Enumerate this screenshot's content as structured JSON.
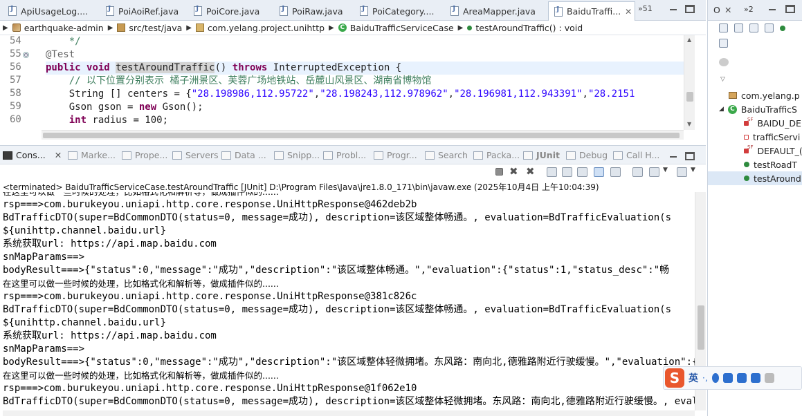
{
  "editor_tabs": [
    {
      "label": "ApiUsageLog...."
    },
    {
      "label": "PoiAoiRef.java"
    },
    {
      "label": "PoiCore.java"
    },
    {
      "label": "PoiRaw.java"
    },
    {
      "label": "PoiCategory...."
    },
    {
      "label": "AreaMapper.java"
    },
    {
      "label": "BaiduTraffi...",
      "active": true
    }
  ],
  "editor_overflow": "»51",
  "breadcrumb": {
    "project": "earthquake-admin",
    "folder": "src/test/java",
    "package": "com.yelang.project.unihttp",
    "class": "BaiduTrafficServiceCase",
    "method": "testAroundTraffic() : void"
  },
  "code": {
    "line_numbers": [
      "54",
      "55",
      "56",
      "57",
      "58",
      "59",
      "60"
    ],
    "fold_marker": "⊖",
    "lines": [
      {
        "t1": "    */"
      },
      {
        "ann": "@Test"
      },
      {
        "kw1": "public",
        "kw2": "void",
        "method": "testAroundTraffic",
        "rest": "() ",
        "kw3": "throws",
        "rest2": " InterruptedException {"
      },
      {
        "comment": "    // 以下位置分别表示 橘子洲景区、芙蓉广场地铁站、岳麓山风景区、湖南省博物馆"
      },
      {
        "pre": "    String [] ",
        "var": "centers",
        "eq": " = {",
        "s1": "\"28.198986,112.95722\"",
        "c1": ",",
        "s2": "\"28.198243,112.978962\"",
        "c2": ",",
        "s3": "\"28.196981,112.943391\"",
        "c3": ",",
        "s4": "\"28.2151"
      },
      {
        "pre": "    Gson gson = ",
        "kw": "new",
        "post": " Gson();"
      },
      {
        "kw": "    int",
        "post": " radius = 100;"
      }
    ]
  },
  "console_tabs": [
    {
      "label": "Cons...",
      "active": true
    },
    {
      "label": "Marke..."
    },
    {
      "label": "Prope..."
    },
    {
      "label": "Servers"
    },
    {
      "label": "Data ..."
    },
    {
      "label": "Snipp..."
    },
    {
      "label": "Probl..."
    },
    {
      "label": "Progr..."
    },
    {
      "label": "Search"
    },
    {
      "label": "Packa..."
    },
    {
      "label": "JUnit"
    },
    {
      "label": "Debug"
    },
    {
      "label": "Call H..."
    }
  ],
  "console_status": "<terminated> BaiduTrafficServiceCase.testAroundTraffic [JUnit] D:\\Program Files\\Java\\jre1.8.0_171\\bin\\javaw.exe (2025年10月4日 上午10:04:39)",
  "console_lines": [
    {
      "text": "在这里可以做一些时候的处理，比如格式化和解析等，做成插件似的......",
      "cn": true
    },
    {
      "text": "rsp===>com.burukeyou.uniapi.http.core.response.UniHttpResponse@462deb2b"
    },
    {
      "text": "BdTrafficDTO(super=BdCommonDTO(status=0, message=成功), description=该区域整体畅通。, evaluation=BdTrafficEvaluation(s"
    },
    {
      "text": "${unihttp.channel.baidu.url}"
    },
    {
      "text": "系统获取url: https://api.map.baidu.com"
    },
    {
      "text": "snMapParams==>"
    },
    {
      "text": "bodyResult===>{\"status\":0,\"message\":\"成功\",\"description\":\"该区域整体畅通。\",\"evaluation\":{\"status\":1,\"status_desc\":\"畅"
    },
    {
      "text": "在这里可以做一些时候的处理，比如格式化和解析等，做成插件似的......",
      "cn": true
    },
    {
      "text": "rsp===>com.burukeyou.uniapi.http.core.response.UniHttpResponse@381c826c"
    },
    {
      "text": "BdTrafficDTO(super=BdCommonDTO(status=0, message=成功), description=该区域整体畅通。, evaluation=BdTrafficEvaluation(s"
    },
    {
      "text": "${unihttp.channel.baidu.url}"
    },
    {
      "text": "系统获取url: https://api.map.baidu.com"
    },
    {
      "text": "snMapParams==>"
    },
    {
      "text": "bodyResult===>{\"status\":0,\"message\":\"成功\",\"description\":\"该区域整体轻微拥堵。东风路：南向北,德雅路附近行驶缓慢。\",\"evaluation\":{\""
    },
    {
      "text": "在这里可以做一些时候的处理，比如格式化和解析等，做成插件似的......",
      "cn": true
    },
    {
      "text": "rsp===>com.burukeyou.uniapi.http.core.response.UniHttpResponse@1f062e10"
    },
    {
      "text": "BdTrafficDTO(super=BdCommonDTO(status=0, message=成功), description=该区域整体轻微拥堵。东风路：南向北,德雅路附近行驶缓慢。, evalu"
    }
  ],
  "outline_tabs": [
    {
      "label": "O"
    },
    {
      "label": "»2"
    }
  ],
  "outline_items": [
    {
      "label": "com.yelang.p",
      "kind": "package"
    },
    {
      "label": "BaiduTrafficS",
      "kind": "class"
    },
    {
      "label": "BAIDU_DE",
      "kind": "field-sf"
    },
    {
      "label": "trafficServi",
      "kind": "field"
    },
    {
      "label": "DEFAULT_(",
      "kind": "field-sf"
    },
    {
      "label": "testRoadT",
      "kind": "method"
    },
    {
      "label": "testAround",
      "kind": "method",
      "selected": true
    }
  ],
  "ime": {
    "logo": "S",
    "mode": "英"
  }
}
